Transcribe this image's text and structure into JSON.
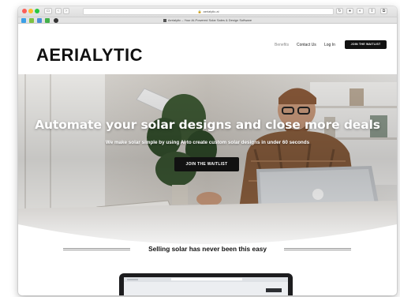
{
  "browser": {
    "url": "aerialytic.ai",
    "tab_title": "Aerialytic – Your AI-Powered Solar Sales & Design Software",
    "nav_back": "‹",
    "nav_forward": "›"
  },
  "site": {
    "logo": "AERIALYTIC",
    "nav": {
      "benefits": "Benefits",
      "contact": "Contact Us",
      "login": "Log In",
      "cta": "JOIN THE WAITLIST"
    }
  },
  "hero": {
    "title": "Automate your solar designs and close more deals",
    "subtitle": "We make solar simple by using AI to create custom solar designs in under 60 seconds",
    "cta": "JOIN THE WAITLIST"
  },
  "tagline": "Selling solar has never been this easy",
  "colors": {
    "primary_button": "#111111",
    "nav_active": "#8a8a8a",
    "hero_text": "#ffffff"
  },
  "icons": [
    "lock-icon",
    "share-icon",
    "reader-icon",
    "tabs-icon",
    "laptop-icon",
    "sidebar-icon"
  ]
}
